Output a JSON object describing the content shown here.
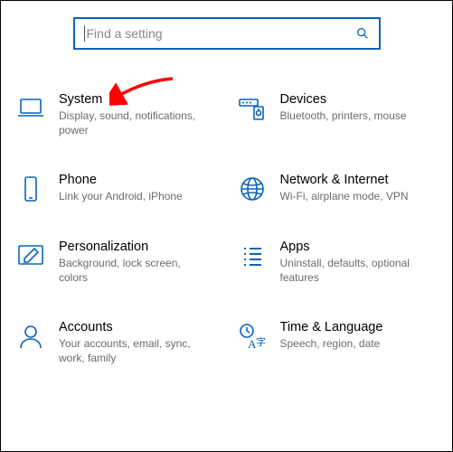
{
  "search": {
    "placeholder": "Find a setting"
  },
  "tiles": [
    {
      "icon": "laptop-icon",
      "title": "System",
      "desc": "Display, sound, notifications, power"
    },
    {
      "icon": "devices-icon",
      "title": "Devices",
      "desc": "Bluetooth, printers, mouse"
    },
    {
      "icon": "phone-icon",
      "title": "Phone",
      "desc": "Link your Android, iPhone"
    },
    {
      "icon": "network-icon",
      "title": "Network & Internet",
      "desc": "Wi-Fi, airplane mode, VPN"
    },
    {
      "icon": "brush-icon",
      "title": "Personalization",
      "desc": "Background, lock screen, colors"
    },
    {
      "icon": "apps-icon",
      "title": "Apps",
      "desc": "Uninstall, defaults, optional features"
    },
    {
      "icon": "person-icon",
      "title": "Accounts",
      "desc": "Your accounts, email, sync, work, family"
    },
    {
      "icon": "clock-lang-icon",
      "title": "Time & Language",
      "desc": "Speech, region, date"
    }
  ],
  "accent": "#0a63b8",
  "annotation": {
    "arrow_color": "#ff0000",
    "points_to": "System"
  }
}
